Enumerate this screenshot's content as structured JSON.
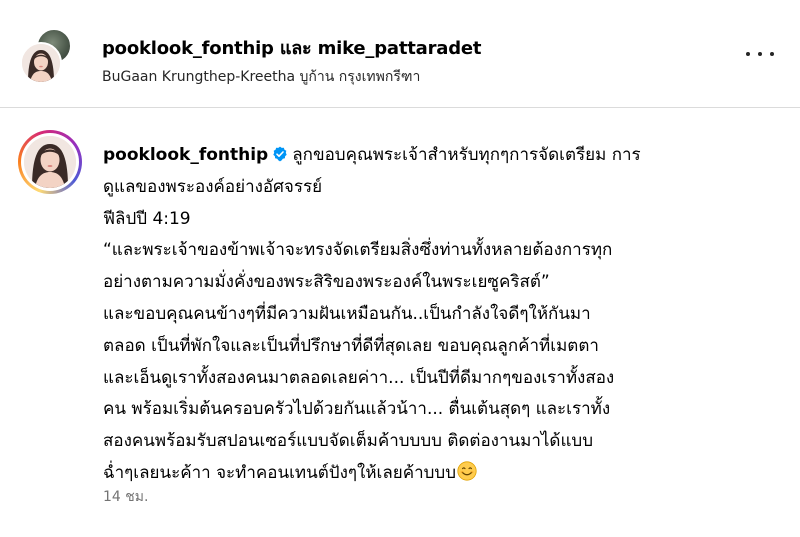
{
  "header": {
    "user_primary": "pooklook_fonthip",
    "and_word": "และ",
    "user_secondary": "mike_pattaradet",
    "location": "BuGaan Krungthep-Kreetha บูก้าน กรุงเทพกรีฑา",
    "more_icon": "more-horizontal-icon"
  },
  "post": {
    "author": "pooklook_fonthip",
    "verified_icon": "verified-badge-icon",
    "caption_lines": [
      "ลูกขอบคุณพระเจ้าสำหรับทุกๆการจัดเตรียม การ",
      "ดูแลของพระองค์อย่างอัศจรรย์",
      "ฟีลิปปี 4:19",
      "“และพระเจ้าของข้าพเจ้าจะทรงจัดเตรียมสิ่งซึ่งท่านทั้งหลายต้องการทุก",
      "อย่างตามความมั่งคั่งของพระสิริของพระองค์ในพระเยซูคริสต์”",
      "และขอบคุณคนข้างๆที่มีความฝันเหมือนกัน..เป็นกำลังใจดีๆให้กันมา",
      "ตลอด เป็นที่พักใจและเป็นที่ปรึกษาที่ดีที่สุดเลย ขอบคุณลูกค้าที่เมตตา",
      "และเอ็นดูเราทั้งสองคนมาตลอดเลยค่าา... เป็นปีที่ดีมากๆของเราทั้งสอง",
      "คน พร้อมเริ่มต้นครอบครัวไปด้วยกันแล้วน้าา... ตื่นเต้นสุดๆ และเราทั้ง",
      "สองคนพร้อมรับสปอนเซอร์แบบจัดเต็มค้าบบบบ ติดต่องานมาได้แบบ",
      "ฉ่ำๆเลยนะค้าา จะทำคอนเทนต์ปังๆให้เลยค้าบบบ"
    ],
    "emoji_icon": "smiling-face-emoji-icon",
    "timestamp": "14 ชม."
  },
  "colors": {
    "verified": "#0095f6",
    "secondary_text": "#737373",
    "divider": "#dbdbdb"
  }
}
